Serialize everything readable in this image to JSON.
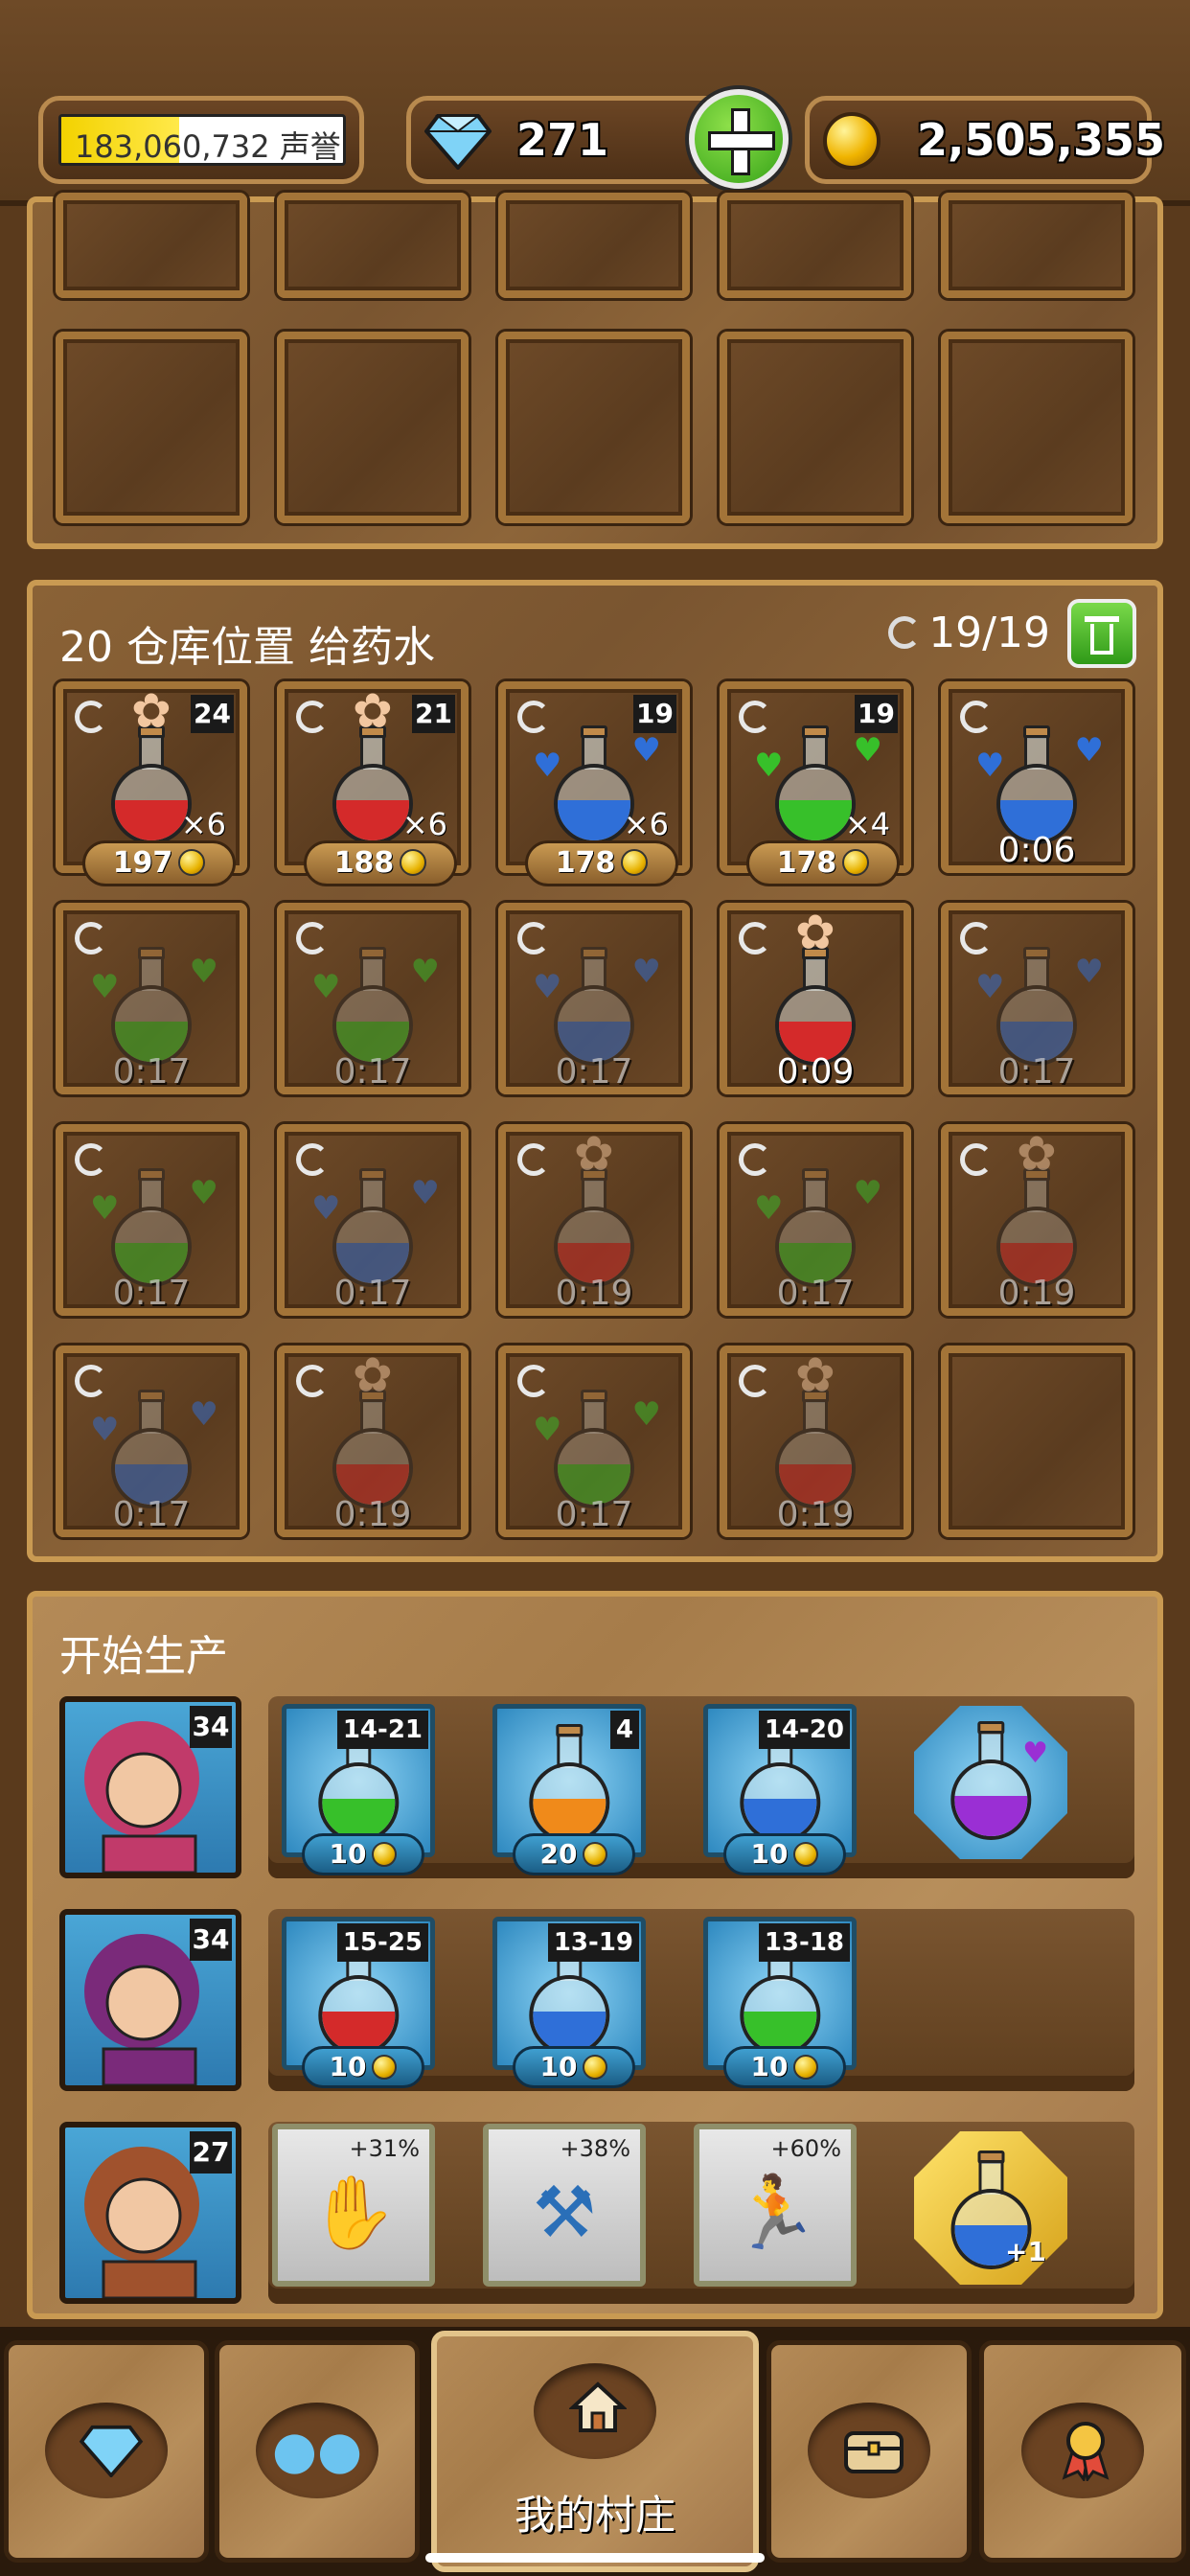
{
  "topbar": {
    "reputation_value": "183,060,732",
    "reputation_label": "声誉",
    "reputation_progress": 0.42,
    "gems": "271",
    "gold": "2,505,355"
  },
  "storage": {
    "title": "20 仓库位置 给药水",
    "capacity": "19/19",
    "slots": [
      {
        "kind": "flower",
        "color": "#d42a2a",
        "level": "24",
        "count": "×6",
        "price": "197"
      },
      {
        "kind": "flower",
        "color": "#d42a2a",
        "level": "21",
        "count": "×6",
        "price": "188"
      },
      {
        "kind": "hearts",
        "color": "#2f6fd8",
        "level": "19",
        "count": "×6",
        "price": "178"
      },
      {
        "kind": "hearts",
        "color": "#37c02a",
        "level": "19",
        "count": "×4",
        "price": "178"
      },
      {
        "kind": "hearts",
        "color": "#2f6fd8",
        "timer": "0:06"
      },
      {
        "kind": "hearts",
        "color": "#37c02a",
        "timer": "0:17",
        "dim": true
      },
      {
        "kind": "hearts",
        "color": "#37c02a",
        "timer": "0:17",
        "dim": true
      },
      {
        "kind": "hearts",
        "color": "#2f6fd8",
        "timer": "0:17",
        "dim": true
      },
      {
        "kind": "flower",
        "color": "#d42a2a",
        "timer": "0:09"
      },
      {
        "kind": "hearts",
        "color": "#2f6fd8",
        "timer": "0:17",
        "dim": true
      },
      {
        "kind": "hearts",
        "color": "#37c02a",
        "timer": "0:17",
        "dim": true
      },
      {
        "kind": "hearts",
        "color": "#2f6fd8",
        "timer": "0:17",
        "dim": true
      },
      {
        "kind": "flower",
        "color": "#d42a2a",
        "timer": "0:19",
        "dim": true
      },
      {
        "kind": "hearts",
        "color": "#37c02a",
        "timer": "0:17",
        "dim": true
      },
      {
        "kind": "flower",
        "color": "#d42a2a",
        "timer": "0:19",
        "dim": true
      },
      {
        "kind": "hearts",
        "color": "#2f6fd8",
        "timer": "0:17",
        "dim": true
      },
      {
        "kind": "flower",
        "color": "#d42a2a",
        "timer": "0:19",
        "dim": true
      },
      {
        "kind": "hearts",
        "color": "#37c02a",
        "timer": "0:17",
        "dim": true
      },
      {
        "kind": "flower",
        "color": "#d42a2a",
        "timer": "0:19",
        "dim": true
      },
      {
        "kind": "empty"
      }
    ]
  },
  "production": {
    "title": "开始生产",
    "workers": [
      {
        "level": "34",
        "recipes": [
          {
            "range": "14-21",
            "price": "10",
            "color": "#37c02a"
          },
          {
            "range": "4",
            "price": "20",
            "color": "#f08a1a"
          },
          {
            "range": "14-20",
            "price": "10",
            "color": "#2f6fd8"
          }
        ]
      },
      {
        "level": "34",
        "recipes": [
          {
            "range": "15-25",
            "price": "10",
            "color": "#d42a2a"
          },
          {
            "range": "13-19",
            "price": "10",
            "color": "#2f6fd8"
          },
          {
            "range": "13-18",
            "price": "10",
            "color": "#37c02a"
          }
        ]
      },
      {
        "level": "27",
        "boosts": [
          {
            "pct": "+31%",
            "icon": "hand-coin"
          },
          {
            "pct": "+38%",
            "icon": "hammer"
          },
          {
            "pct": "+60%",
            "icon": "runner"
          }
        ],
        "special_badge": "+1"
      }
    ]
  },
  "nav": {
    "home_label": "我的村庄"
  },
  "colors": {
    "accent_gold": "#c99a52",
    "wood_dark": "#5a3a1c"
  }
}
